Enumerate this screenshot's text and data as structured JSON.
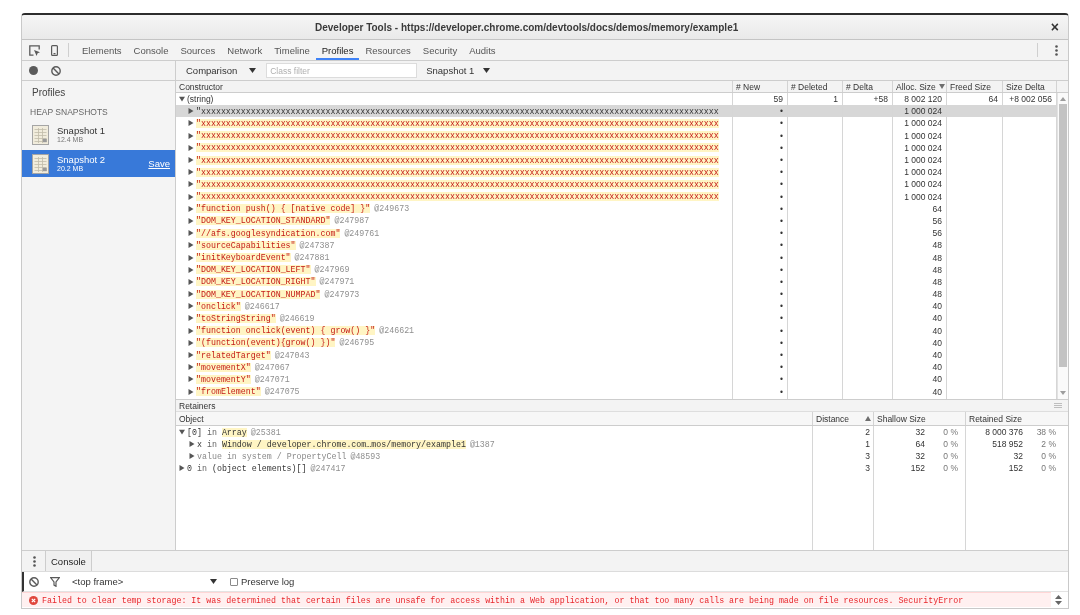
{
  "window": {
    "title": "Developer Tools - https://developer.chrome.com/devtools/docs/demos/memory/example1",
    "close": "×"
  },
  "toolbar": {
    "tabs": [
      {
        "label": "Elements",
        "selected": false
      },
      {
        "label": "Console",
        "selected": false
      },
      {
        "label": "Sources",
        "selected": false
      },
      {
        "label": "Network",
        "selected": false
      },
      {
        "label": "Timeline",
        "selected": false
      },
      {
        "label": "Profiles",
        "selected": true
      },
      {
        "label": "Resources",
        "selected": false
      },
      {
        "label": "Security",
        "selected": false
      },
      {
        "label": "Audits",
        "selected": false
      }
    ]
  },
  "sidebar": {
    "title": "Profiles",
    "section": "HEAP SNAPSHOTS",
    "snapshots": [
      {
        "name": "Snapshot 1",
        "size": "12.4 MB",
        "selected": false
      },
      {
        "name": "Snapshot 2",
        "size": "20.2 MB",
        "selected": true,
        "action": "Save"
      }
    ]
  },
  "filter_bar": {
    "view": "Comparison",
    "class_filter": {
      "placeholder": "Class filter"
    },
    "base_snapshot": "Snapshot 1"
  },
  "heap_table": {
    "columns": [
      {
        "label": "Constructor",
        "sorted": false
      },
      {
        "label": "# New",
        "sorted": false
      },
      {
        "label": "# Deleted",
        "sorted": false
      },
      {
        "label": "# Delta",
        "sorted": false
      },
      {
        "label": "Alloc. Size",
        "sorted": true,
        "descending": true
      },
      {
        "label": "Freed Size",
        "sorted": false
      },
      {
        "label": "Size Delta",
        "sorted": false
      }
    ],
    "rows": [
      {
        "kind": "group",
        "name": "(string)",
        "expanded": true,
        "selected": false,
        "new": "59",
        "deleted": "1",
        "delta": "+58",
        "alloc_size": "8 002 120",
        "freed_size": "64",
        "size_delta": "+8 002 056",
        "children": [
          {
            "kind": "string",
            "value": "\"xxxxxxxxxxxxxxxxxxxxxxxxxxxxxxxxxxxxxxxxxxxxxxxxxxxxxxxxxxxxxxxxxxxxxxxxxxxxxxxxxxxxxxxxxxxxxxxxxxxxxxxx",
            "expanded": false,
            "selected": true,
            "new": "•",
            "alloc_size": "1 000 024"
          },
          {
            "kind": "string",
            "value": "\"xxxxxxxxxxxxxxxxxxxxxxxxxxxxxxxxxxxxxxxxxxxxxxxxxxxxxxxxxxxxxxxxxxxxxxxxxxxxxxxxxxxxxxxxxxxxxxxxxxxxxxxx",
            "expanded": false,
            "selected": false,
            "new": "•",
            "alloc_size": "1 000 024"
          },
          {
            "kind": "string",
            "value": "\"xxxxxxxxxxxxxxxxxxxxxxxxxxxxxxxxxxxxxxxxxxxxxxxxxxxxxxxxxxxxxxxxxxxxxxxxxxxxxxxxxxxxxxxxxxxxxxxxxxxxxxxx",
            "expanded": false,
            "selected": false,
            "new": "•",
            "alloc_size": "1 000 024"
          },
          {
            "kind": "string",
            "value": "\"xxxxxxxxxxxxxxxxxxxxxxxxxxxxxxxxxxxxxxxxxxxxxxxxxxxxxxxxxxxxxxxxxxxxxxxxxxxxxxxxxxxxxxxxxxxxxxxxxxxxxxxx",
            "expanded": false,
            "selected": false,
            "new": "•",
            "alloc_size": "1 000 024"
          },
          {
            "kind": "string",
            "value": "\"xxxxxxxxxxxxxxxxxxxxxxxxxxxxxxxxxxxxxxxxxxxxxxxxxxxxxxxxxxxxxxxxxxxxxxxxxxxxxxxxxxxxxxxxxxxxxxxxxxxxxxxx",
            "expanded": false,
            "selected": false,
            "new": "•",
            "alloc_size": "1 000 024"
          },
          {
            "kind": "string",
            "value": "\"xxxxxxxxxxxxxxxxxxxxxxxxxxxxxxxxxxxxxxxxxxxxxxxxxxxxxxxxxxxxxxxxxxxxxxxxxxxxxxxxxxxxxxxxxxxxxxxxxxxxxxxx",
            "expanded": false,
            "selected": false,
            "new": "•",
            "alloc_size": "1 000 024"
          },
          {
            "kind": "string",
            "value": "\"xxxxxxxxxxxxxxxxxxxxxxxxxxxxxxxxxxxxxxxxxxxxxxxxxxxxxxxxxxxxxxxxxxxxxxxxxxxxxxxxxxxxxxxxxxxxxxxxxxxxxxxx",
            "expanded": false,
            "selected": false,
            "new": "•",
            "alloc_size": "1 000 024"
          },
          {
            "kind": "string",
            "value": "\"xxxxxxxxxxxxxxxxxxxxxxxxxxxxxxxxxxxxxxxxxxxxxxxxxxxxxxxxxxxxxxxxxxxxxxxxxxxxxxxxxxxxxxxxxxxxxxxxxxxxxxxx",
            "expanded": false,
            "selected": false,
            "new": "•",
            "alloc_size": "1 000 024"
          },
          {
            "kind": "string",
            "value": "\"function push() { [native code] }\"",
            "id": "@249673",
            "expanded": false,
            "selected": false,
            "new": "•",
            "alloc_size": "64"
          },
          {
            "kind": "string",
            "value": "\"DOM_KEY_LOCATION_STANDARD\"",
            "id": "@247987",
            "expanded": false,
            "selected": false,
            "new": "•",
            "alloc_size": "56"
          },
          {
            "kind": "string",
            "value": "\"//afs.googlesyndication.com\"",
            "id": "@249761",
            "expanded": false,
            "selected": false,
            "new": "•",
            "alloc_size": "56"
          },
          {
            "kind": "string",
            "value": "\"sourceCapabilities\"",
            "id": "@247387",
            "expanded": false,
            "selected": false,
            "new": "•",
            "alloc_size": "48"
          },
          {
            "kind": "string",
            "value": "\"initKeyboardEvent\"",
            "id": "@247881",
            "expanded": false,
            "selected": false,
            "new": "•",
            "alloc_size": "48"
          },
          {
            "kind": "string",
            "value": "\"DOM_KEY_LOCATION_LEFT\"",
            "id": "@247969",
            "expanded": false,
            "selected": false,
            "new": "•",
            "alloc_size": "48"
          },
          {
            "kind": "string",
            "value": "\"DOM_KEY_LOCATION_RIGHT\"",
            "id": "@247971",
            "expanded": false,
            "selected": false,
            "new": "•",
            "alloc_size": "48"
          },
          {
            "kind": "string",
            "value": "\"DOM_KEY_LOCATION_NUMPAD\"",
            "id": "@247973",
            "expanded": false,
            "selected": false,
            "new": "•",
            "alloc_size": "48"
          },
          {
            "kind": "string",
            "value": "\"onclick\"",
            "id": "@246617",
            "expanded": false,
            "selected": false,
            "new": "•",
            "alloc_size": "40"
          },
          {
            "kind": "string",
            "value": "\"toStringString\"",
            "id": "@246619",
            "expanded": false,
            "selected": false,
            "new": "•",
            "alloc_size": "40"
          },
          {
            "kind": "string",
            "value": "\"function onclick(event) { grow() }\"",
            "id": "@246621",
            "expanded": false,
            "selected": false,
            "new": "•",
            "alloc_size": "40"
          },
          {
            "kind": "string",
            "value": "\"(function(event){grow() })\"",
            "id": "@246795",
            "expanded": false,
            "selected": false,
            "new": "•",
            "alloc_size": "40"
          },
          {
            "kind": "string",
            "value": "\"relatedTarget\"",
            "id": "@247043",
            "expanded": false,
            "selected": false,
            "new": "•",
            "alloc_size": "40"
          },
          {
            "kind": "string",
            "value": "\"movementX\"",
            "id": "@247067",
            "expanded": false,
            "selected": false,
            "new": "•",
            "alloc_size": "40"
          },
          {
            "kind": "string",
            "value": "\"movementY\"",
            "id": "@247071",
            "expanded": false,
            "selected": false,
            "new": "•",
            "alloc_size": "40"
          },
          {
            "kind": "string",
            "value": "\"fromElement\"",
            "id": "@247075",
            "expanded": false,
            "selected": false,
            "new": "•",
            "alloc_size": "40"
          }
        ]
      }
    ]
  },
  "retainers": {
    "title": "Retainers",
    "columns": [
      {
        "label": "Object",
        "sorted": false
      },
      {
        "label": "Distance",
        "sorted": true,
        "descending": false
      },
      {
        "label": "Shallow Size",
        "sorted": false
      },
      {
        "label": "Retained Size",
        "sorted": false
      }
    ],
    "rows": [
      {
        "edge": "[0]",
        "relation": "in",
        "object": "Array",
        "id": "@25381",
        "expanded": true,
        "highlighted": true,
        "dimmed": false,
        "distance": "2",
        "shallow_size": "32",
        "shallow_percent": "0 %",
        "retained_size": "8 000 376",
        "retained_percent": "38 %",
        "children": [
          {
            "edge": "x",
            "relation": "in",
            "object": "Window / developer.chrome.com…mos/memory/example1",
            "id": "@1387",
            "expanded": false,
            "highlighted": true,
            "dimmed": false,
            "distance": "1",
            "shallow_size": "64",
            "shallow_percent": "0 %",
            "retained_size": "518 952",
            "retained_percent": "2 %"
          },
          {
            "edge": "value",
            "relation": "in",
            "object": "system / PropertyCell",
            "id": "@48593",
            "expanded": false,
            "highlighted": false,
            "dimmed": true,
            "distance": "3",
            "shallow_size": "32",
            "shallow_percent": "0 %",
            "retained_size": "32",
            "retained_percent": "0 %"
          }
        ]
      },
      {
        "edge": "0",
        "relation": "in",
        "object": "(object elements)[]",
        "id": "@247417",
        "expanded": false,
        "highlighted": false,
        "dimmed": false,
        "distance": "3",
        "shallow_size": "152",
        "shallow_percent": "0 %",
        "retained_size": "152",
        "retained_percent": "0 %"
      }
    ]
  },
  "drawer": {
    "tabs": [
      {
        "label": "Console",
        "selected": true
      }
    ],
    "context": "<top frame>",
    "preserve_log": {
      "label": "Preserve log",
      "checked": false
    },
    "messages": [
      {
        "kind": "error",
        "text": "Failed to clear temp storage: It was determined that certain files are unsafe for access within a Web application, or that too many calls are being made on file resources. SecurityError"
      }
    ]
  }
}
